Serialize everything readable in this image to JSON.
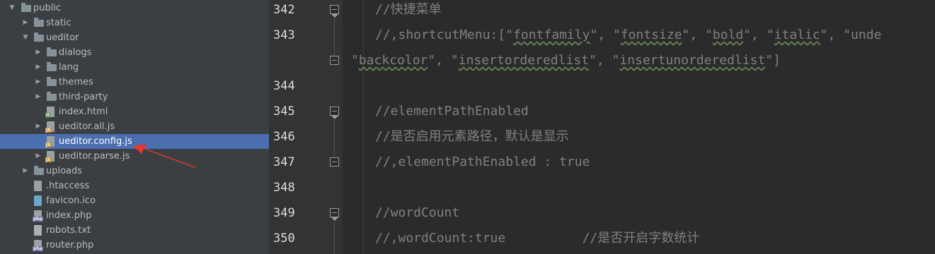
{
  "tree": {
    "items": [
      {
        "label": "public",
        "kind": "folder",
        "arrow": "▼"
      },
      {
        "label": "static",
        "kind": "folder",
        "arrow": "▶"
      },
      {
        "label": "ueditor",
        "kind": "folder",
        "arrow": "▼"
      },
      {
        "label": "dialogs",
        "kind": "folder",
        "arrow": "▶"
      },
      {
        "label": "lang",
        "kind": "folder",
        "arrow": "▶"
      },
      {
        "label": "themes",
        "kind": "folder",
        "arrow": "▶"
      },
      {
        "label": "third-party",
        "kind": "folder",
        "arrow": "▶"
      },
      {
        "label": "index.html",
        "kind": "html",
        "arrow": ""
      },
      {
        "label": "ueditor.all.js",
        "kind": "js",
        "arrow": "▶"
      },
      {
        "label": "ueditor.config.js",
        "kind": "js",
        "arrow": "",
        "selected": true
      },
      {
        "label": "ueditor.parse.js",
        "kind": "js",
        "arrow": "▶"
      },
      {
        "label": "uploads",
        "kind": "folder",
        "arrow": "▶"
      },
      {
        "label": ".htaccess",
        "kind": "ht",
        "arrow": ""
      },
      {
        "label": "favicon.ico",
        "kind": "ico",
        "arrow": ""
      },
      {
        "label": "index.php",
        "kind": "php",
        "arrow": ""
      },
      {
        "label": "robots.txt",
        "kind": "txt",
        "arrow": ""
      },
      {
        "label": "router.php",
        "kind": "php",
        "arrow": ""
      }
    ],
    "tags": {
      "js": "JS",
      "html": "H",
      "php": "php"
    }
  },
  "editor": {
    "line_numbers": [
      "342",
      "343",
      "",
      "344",
      "345",
      "346",
      "347",
      "348",
      "349",
      "350"
    ],
    "lines": [
      {
        "text": "//快捷菜单"
      },
      {
        "text": "//,shortcutMenu:[\"fontfamily\", \"fontsize\", \"bold\", \"italic\", \"unde"
      },
      {
        "text": "\"backcolor\", \"insertorderedlist\", \"insertunorderedlist\"]"
      },
      {
        "text": ""
      },
      {
        "text": "//elementPathEnabled"
      },
      {
        "text": "//是否启用元素路径，默认是显示"
      },
      {
        "text": "//,elementPathEnabled : true"
      },
      {
        "text": ""
      },
      {
        "text": "//wordCount"
      },
      {
        "text": "//,wordCount:true          //是否开启字数统计"
      }
    ]
  },
  "colors": {
    "selection": "#4b6eaf",
    "comment": "#808080",
    "annotation_arrow": "#e8392b"
  }
}
